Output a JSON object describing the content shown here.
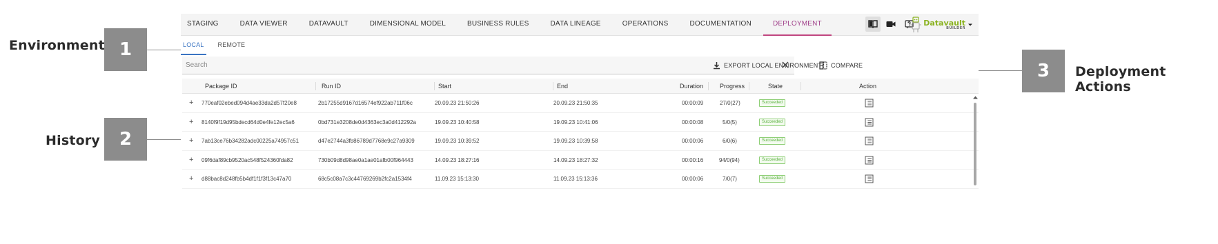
{
  "annotations": {
    "items": [
      {
        "number": "1",
        "label": "Environment"
      },
      {
        "number": "2",
        "label": "History"
      },
      {
        "number": "3",
        "label": "Deployment Actions"
      }
    ],
    "color": "#8c8c8c"
  },
  "nav": {
    "items": [
      {
        "label": "STAGING"
      },
      {
        "label": "DATA VIEWER"
      },
      {
        "label": "DATAVAULT"
      },
      {
        "label": "DIMENSIONAL MODEL"
      },
      {
        "label": "BUSINESS RULES"
      },
      {
        "label": "DATA LINEAGE"
      },
      {
        "label": "OPERATIONS"
      },
      {
        "label": "DOCUMENTATION"
      },
      {
        "label": "DEPLOYMENT",
        "active": true
      }
    ],
    "active_color": "#c0457f",
    "icons": [
      "book-icon",
      "video-camera-icon",
      "help-icon"
    ]
  },
  "logo": {
    "name": "Datavault",
    "sub": "BUILDER",
    "color": "#8ab21f"
  },
  "subtabs": {
    "items": [
      {
        "label": "LOCAL",
        "active": true
      },
      {
        "label": "REMOTE"
      }
    ],
    "active_color": "#3a74c2"
  },
  "search": {
    "placeholder": "Search",
    "value": ""
  },
  "actions": {
    "export_label": "EXPORT LOCAL ENVIRONMENT",
    "compare_label": "COMPARE"
  },
  "table": {
    "columns": {
      "package_id": "Package ID",
      "run_id": "Run ID",
      "start": "Start",
      "end": "End",
      "duration": "Duration",
      "progress": "Progress",
      "state": "State",
      "action": "Action"
    },
    "rows": [
      {
        "package_id": "770eaf02ebed094d4ae33da2d57f20e8",
        "run_id": "2b17255d9167d16574ef922ab711f06c",
        "start": "20.09.23 21:50:26",
        "end": "20.09.23 21:50:35",
        "duration": "00:00:09",
        "progress": "27/0(27)",
        "state": "Succeeded"
      },
      {
        "package_id": "8140f9f19d95bdecd64d0e4fe12ec5a6",
        "run_id": "0bd731e3208de0d4363ec3a0d412292a",
        "start": "19.09.23 10:40:58",
        "end": "19.09.23 10:41:06",
        "duration": "00:00:08",
        "progress": "5/0(5)",
        "state": "Succeeded"
      },
      {
        "package_id": "7ab13ce76b34282adc00225a74957c51",
        "run_id": "d47e2744a3fb86789d7768e9c27a9309",
        "start": "19.09.23 10:39:52",
        "end": "19.09.23 10:39:58",
        "duration": "00:00:06",
        "progress": "6/0(6)",
        "state": "Succeeded"
      },
      {
        "package_id": "09f6daf89cb9520ac548f524360fda82",
        "run_id": "730b09d8d98ae0a1ae01afb00f964443",
        "start": "14.09.23 18:27:16",
        "end": "14.09.23 18:27:32",
        "duration": "00:00:16",
        "progress": "94/0(94)",
        "state": "Succeeded"
      },
      {
        "package_id": "d88bac8d248fb5b4df1f1f3f13c47a70",
        "run_id": "68c5c08a7c3c44769269b2fc2a1534f4",
        "start": "11.09.23 15:13:30",
        "end": "11.09.23 15:13:36",
        "duration": "00:00:06",
        "progress": "7/0(7)",
        "state": "Succeeded"
      }
    ],
    "expand_symbol": "+",
    "state_color": "#58b03c",
    "row_action_icon": "list-icon"
  }
}
